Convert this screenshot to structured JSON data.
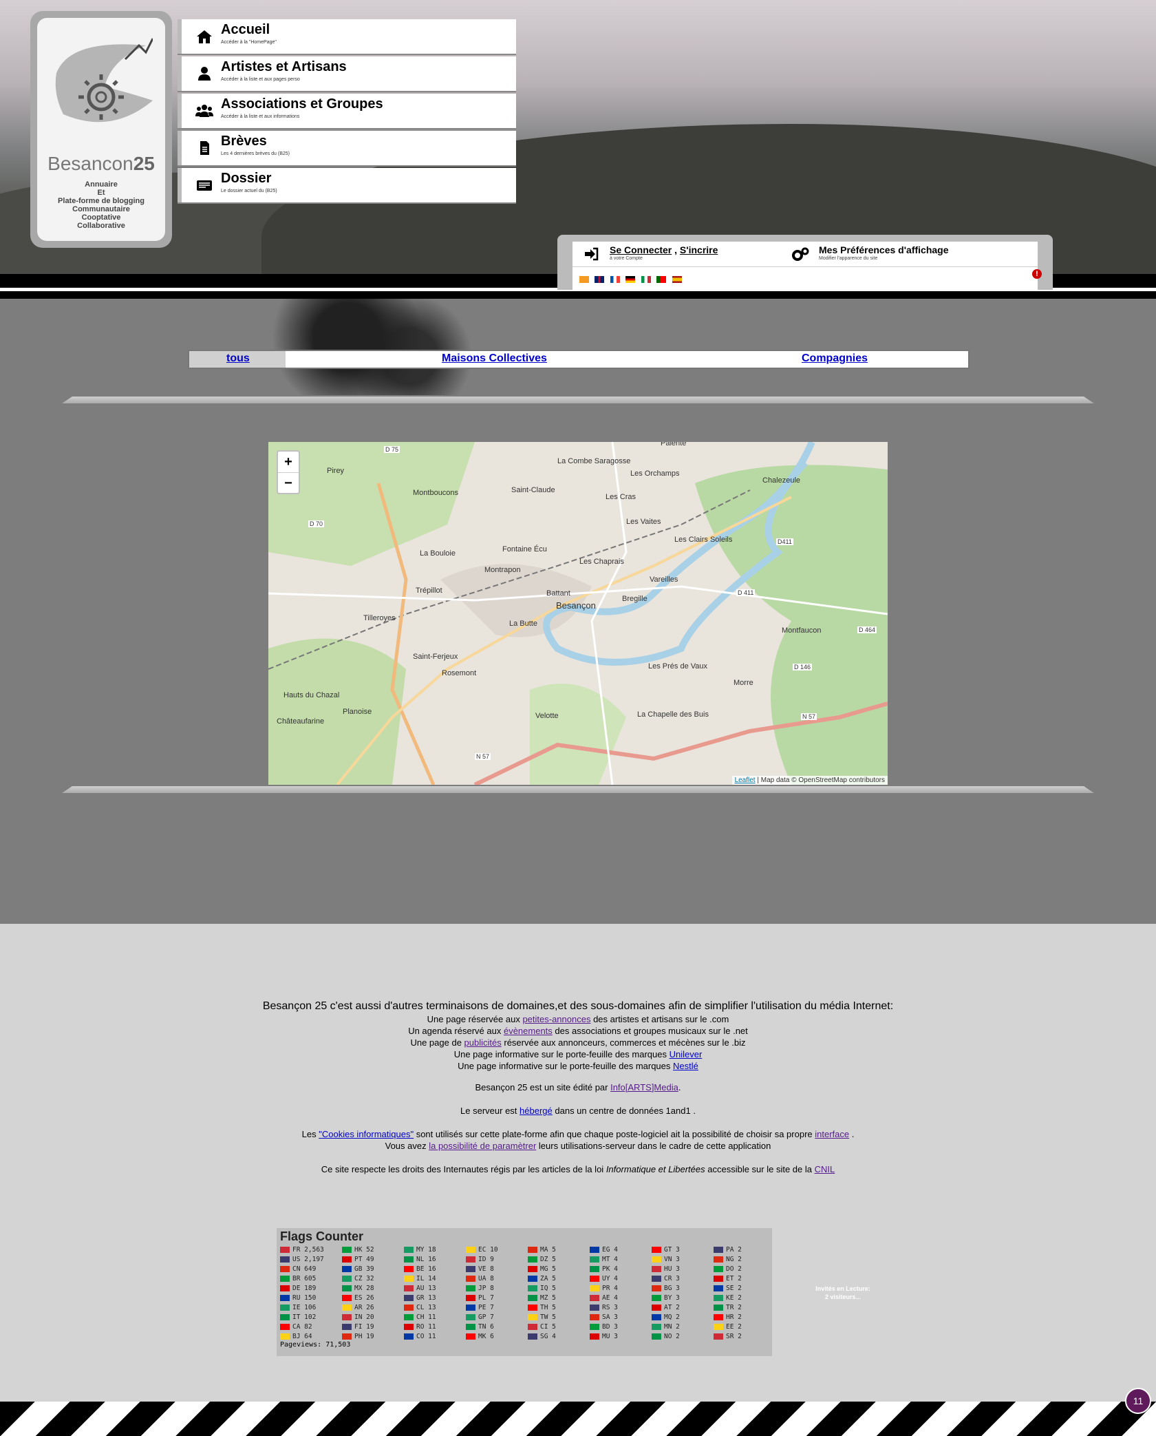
{
  "logo": {
    "title_a": "Besancon",
    "title_b": "25",
    "subtitle": [
      "Annuaire",
      "Et",
      "Plate-forme de blogging",
      "Communautaire",
      "Cooptative",
      "Collaborative"
    ]
  },
  "nav": [
    {
      "icon": "home-icon",
      "title": "Accueil",
      "sub": "Accéder à la \"HomePage\""
    },
    {
      "icon": "user-icon",
      "title": "Artistes et Artisans",
      "sub": "Accéder à la liste et aux pages perso"
    },
    {
      "icon": "users-icon",
      "title": "Associations et Groupes",
      "sub": "Accéder à la liste et aux informations"
    },
    {
      "icon": "file-icon",
      "title": "Brèves",
      "sub": "Les 4 dernières brèves du (B25)"
    },
    {
      "icon": "newspaper-icon",
      "title": "Dossier",
      "sub": "Le dossier actuel du (B25)"
    }
  ],
  "login": {
    "connect": "Se Connecter",
    "separator": ",",
    "register": "S'incrire",
    "connect_sub": "à votre Compte",
    "prefs": "Mes Préférences d'affichage",
    "prefs_sub": "Modifier l'apparence du site",
    "alert": "!"
  },
  "tabs": [
    "tous",
    "Maisons Collectives",
    "Compagnies"
  ],
  "map": {
    "zoom_in": "+",
    "zoom_out": "−",
    "attr_leaflet": "Leaflet",
    "attr_rest": " | Map data © OpenStreetMap contributors",
    "labels": [
      "Palente",
      "La Combe Saragosse",
      "Les Orchamps",
      "Chalezeule",
      "Pirey",
      "Montboucons",
      "Saint-Claude",
      "Les Cras",
      "Les Vaites",
      "Les Clairs Soleils",
      "La Bouloie",
      "Fontaine Écu",
      "Montrapon",
      "Les Chaprais",
      "Vareilles",
      "Trépillot",
      "Battant",
      "Besançon",
      "Bregille",
      "Tilleroyes",
      "La Butte",
      "Montfaucon",
      "Saint-Ferjeux",
      "Rosemont",
      "Les Prés de Vaux",
      "Hauts du Chazal",
      "Planoise",
      "Châteaufarine",
      "Velotte",
      "La Chapelle des Buis",
      "Morre",
      "D 75",
      "D 70",
      "D411",
      "D 411",
      "D 464",
      "D 146",
      "N 57",
      "N 57"
    ]
  },
  "footer": {
    "intro": "Besançon 25 c'est aussi d'autres terminaisons de domaines,et des sous-domaines afin de simplifier l'utilisation du média Internet:",
    "l1a": "Une page réservée aux ",
    "l1link": "petites-annonces",
    "l1b": " des artistes et artisans sur le .com",
    "l2a": "Un agenda réservé aux ",
    "l2link": "évènements",
    "l2b": " des associations et groupes musicaux sur le .net",
    "l3a": "Une page de ",
    "l3link": "publicités",
    "l3b": " réservée aux annonceurs, commerces et mécènes sur le .biz",
    "l4a": "Une page informative sur le porte-feuille des marques ",
    "l4link": "Unilever",
    "l5a": "Une page informative sur le porte-feuille des marques ",
    "l5link": "Nestlé",
    "l6a": "Besançon 25 est un site édité par ",
    "l6link": "Info[ARTS]Media",
    "l6b": ".",
    "l7a": "Le serveur est ",
    "l7link": "hébergé",
    "l7b": " dans un centre de données 1and1 .",
    "l8a": "Les ",
    "l8link": "\"Cookies informatiques\"",
    "l8b": " sont utilisés sur cette plate-forme afin que chaque poste-logiciel ait la possibilité de choisir sa propre ",
    "l8link2": "interface",
    "l8c": " .",
    "l9a": "Vous avez ",
    "l9link": "la possibilité de paramètrer",
    "l9b": " leurs utilisations-serveur dans le cadre de cette application",
    "l10a": "Ce site respecte les droits des Internautes régis par les articles de la loi ",
    "l10em": "Informatique et Libertées",
    "l10b": " accessible sur le site de la ",
    "l10link": "CNIL"
  },
  "flags_counter": {
    "title": "Flags Counter",
    "pageviews": "Pageviews: 71,503",
    "columns": [
      [
        "FR 2,563",
        "US 2,197",
        "CN 649",
        "BR 605",
        "DE 189",
        "RU 150",
        "IE 106",
        "IT 102",
        "CA 82",
        "BJ 64"
      ],
      [
        "HK 52",
        "PT 49",
        "GB 39",
        "CZ 32",
        "MX 28",
        "ES 26",
        "AR 26",
        "IN 20",
        "FI 19",
        "PH 19"
      ],
      [
        "MY 18",
        "NL 16",
        "BE 16",
        "IL 14",
        "AU 13",
        "GR 13",
        "CL 13",
        "CH 11",
        "RO 11",
        "CO 11"
      ],
      [
        "EC 10",
        "ID 9",
        "VE 8",
        "UA 8",
        "JP 8",
        "PL 7",
        "PE 7",
        "GP 7",
        "TN 6",
        "MK 6"
      ],
      [
        "MA 5",
        "DZ 5",
        "MG 5",
        "ZA 5",
        "IQ 5",
        "MZ 5",
        "TH 5",
        "TW 5",
        "CI 5",
        "SG 4"
      ],
      [
        "EG 4",
        "MT 4",
        "PK 4",
        "UY 4",
        "PR 4",
        "AE 4",
        "RS 3",
        "SA 3",
        "BD 3",
        "MU 3"
      ],
      [
        "GT 3",
        "VN 3",
        "HU 3",
        "CR 3",
        "BG 3",
        "BY 3",
        "AT 2",
        "MQ 2",
        "MN 2",
        "NO 2"
      ],
      [
        "PA 2",
        "NG 2",
        "DO 2",
        "ET 2",
        "SE 2",
        "KE 2",
        "TR 2",
        "HR 2",
        "EE 2",
        "SR 2"
      ]
    ]
  },
  "guests": {
    "line1": "Invités en Lecture:",
    "line2": "2 visiteurs..."
  },
  "badge": "11"
}
